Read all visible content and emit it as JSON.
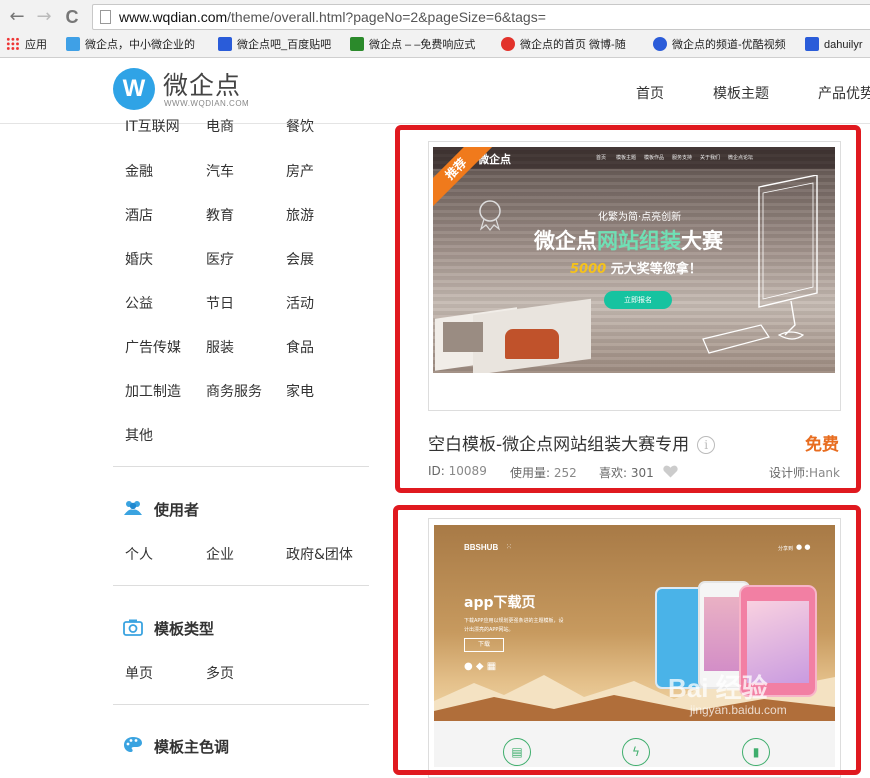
{
  "browser": {
    "back": "←",
    "forward": "→",
    "reload": "C",
    "url_host": "www.wqdian.com",
    "url_rest": "/theme/overall.html?pageNo=2&pageSize=6&tags=",
    "bookmarks": [
      {
        "label": "应用",
        "color": "#e44"
      },
      {
        "label": "微企点，中小微企业的",
        "color": "#3fa0e6"
      },
      {
        "label": "微企点吧_百度贴吧",
        "color": "#2a5cd9"
      },
      {
        "label": "微企点 – –免费响应式",
        "color": "#2b8a2b"
      },
      {
        "label": "微企点的首页 微博-随",
        "color": "#e2322b"
      },
      {
        "label": "微企点的频道-优酷视频",
        "color": "#2b5cd9"
      },
      {
        "label": "dahuilyr",
        "color": "#2a5cd9"
      }
    ]
  },
  "site": {
    "logo_mark": "W",
    "logo_text": "微企点",
    "logo_sub": "WWW.WQDIAN.COM",
    "nav": [
      "首页",
      "模板主题",
      "产品优势"
    ]
  },
  "sidebar": {
    "industry_rows": [
      [
        "IT互联网",
        "电商",
        "餐饮"
      ],
      [
        "金融",
        "汽车",
        "房产"
      ],
      [
        "酒店",
        "教育",
        "旅游"
      ],
      [
        "婚庆",
        "医疗",
        "会展"
      ],
      [
        "公益",
        "节日",
        "活动"
      ],
      [
        "广告传媒",
        "服装",
        "食品"
      ],
      [
        "加工制造",
        "商务服务",
        "家电"
      ],
      [
        "其他"
      ]
    ],
    "users": {
      "title": "使用者",
      "items": [
        "个人",
        "企业",
        "政府&团体"
      ]
    },
    "template_type": {
      "title": "模板类型",
      "items": [
        "单页",
        "多页"
      ]
    },
    "main_color": {
      "title": "模板主色调"
    }
  },
  "cards": [
    {
      "badge": "推荐",
      "thumb_logo": "微企点",
      "thumb_nav": [
        "首页",
        "模板主题",
        "模板作品",
        "服务支持",
        "关于我们",
        "微企点论坛"
      ],
      "thumb_tagline": "化繁为简·点亮创新",
      "thumb_headline_a": "微企点",
      "thumb_headline_b": "网站组装",
      "thumb_headline_c": "大赛",
      "thumb_sub_a": "5000",
      "thumb_sub_b": " 元大奖等您拿！",
      "thumb_button": "立即报名",
      "title": "空白模板-微企点网站组装大赛专用",
      "price": "免费",
      "id_label": "ID:",
      "id": "10089",
      "usage_label": "使用量:",
      "usage": "252",
      "likes_label": "喜欢:",
      "likes": "301",
      "designer_label": "设计师:",
      "designer": "Hank"
    },
    {
      "thumb_brand": "BBSHUB",
      "thumb_share": "分享到",
      "thumb_title": "app下载页",
      "thumb_desc_1": "下载APP应用以规划更强条进的主题模板，设",
      "thumb_desc_2": "计出漂亮的APP网站。",
      "thumb_button": "下载"
    }
  ],
  "watermark": {
    "text": "Bai 经验",
    "sub": "jingyan.baidu.com"
  }
}
